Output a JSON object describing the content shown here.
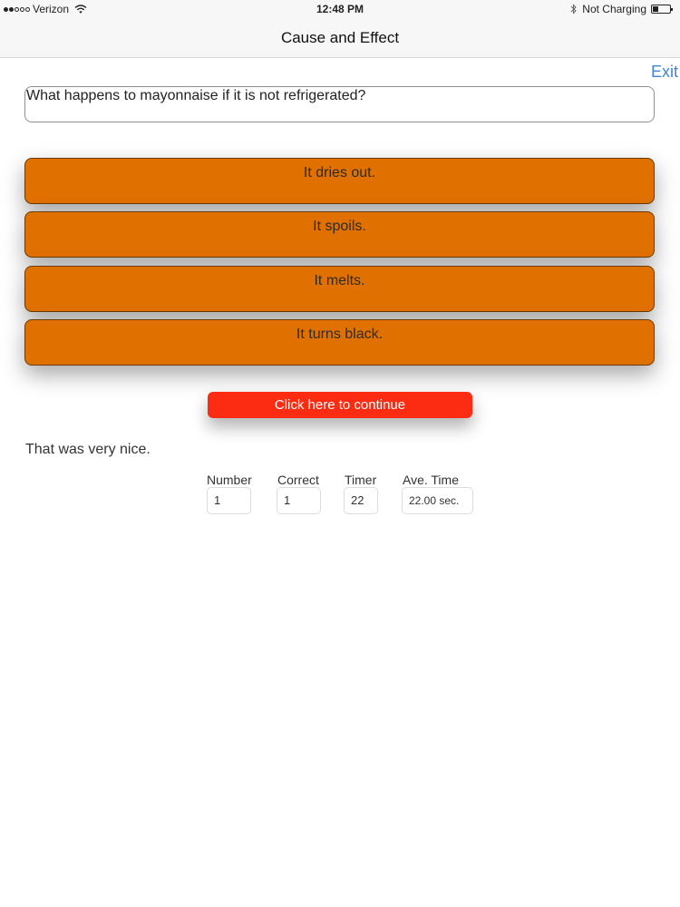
{
  "status_bar": {
    "carrier": "Verizon",
    "time": "12:48 PM",
    "charging": "Not Charging"
  },
  "nav": {
    "title": "Cause and Effect"
  },
  "exit_label": "Exit",
  "question": "What happens to mayonnaise if it is not refrigerated?",
  "answers": [
    {
      "label": "It dries out."
    },
    {
      "label": "It spoils."
    },
    {
      "label": "It melts."
    },
    {
      "label": "It turns black."
    }
  ],
  "continue_label": "Click here to continue",
  "feedback": "That was very nice.",
  "stats": {
    "number": {
      "label": "Number",
      "value": "1"
    },
    "correct": {
      "label": "Correct",
      "value": "1"
    },
    "timer": {
      "label": "Timer",
      "value": "22"
    },
    "ave_time": {
      "label": "Ave. Time",
      "value": "22.00 sec."
    }
  },
  "colors": {
    "answer_bg": "#e07000",
    "continue_bg": "#fb2c12",
    "link": "#3f86d8"
  }
}
